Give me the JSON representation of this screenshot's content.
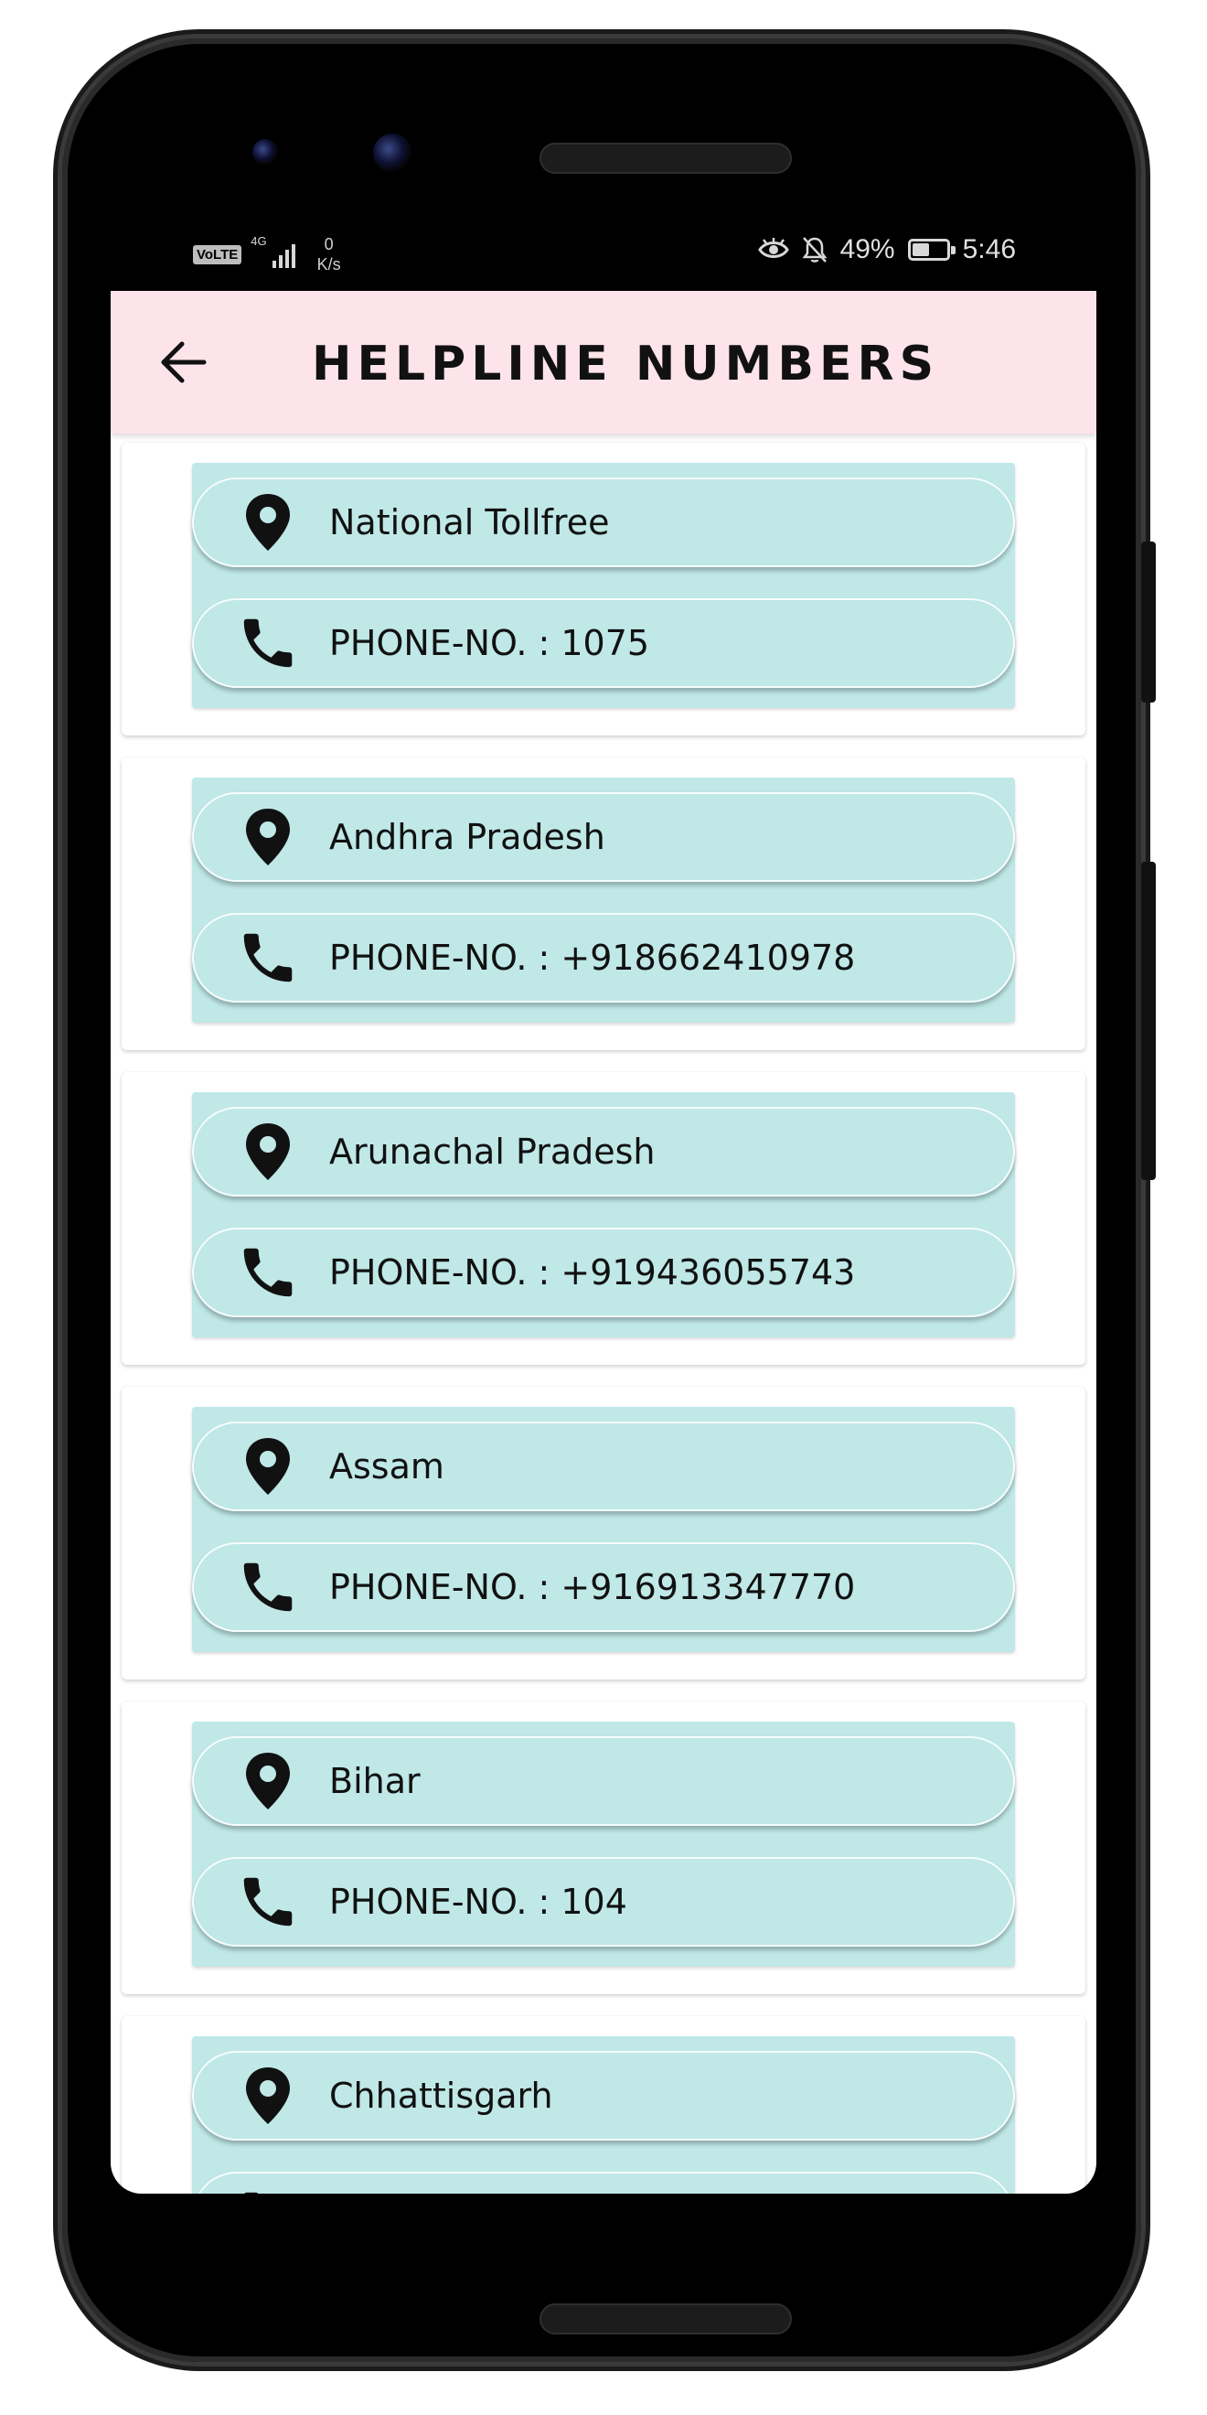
{
  "status_bar": {
    "volte": "VoLTE",
    "network": "4G",
    "speed_value": "0",
    "speed_unit": "K/s",
    "battery": "49%",
    "battery_level": 0.49,
    "time": "5:46"
  },
  "app_bar": {
    "title": "HELPLINE NUMBERS",
    "background": "#fde4ea"
  },
  "colors": {
    "card_inner": "#bfe8e7",
    "accent_text": "#111111"
  },
  "helplines": [
    {
      "location": "National Tollfree",
      "phone": "PHONE-NO. : 1075"
    },
    {
      "location": "Andhra Pradesh",
      "phone": "PHONE-NO. : +918662410978"
    },
    {
      "location": "Arunachal Pradesh",
      "phone": "PHONE-NO. : +919436055743"
    },
    {
      "location": "Assam",
      "phone": "PHONE-NO. : +916913347770"
    },
    {
      "location": "Bihar",
      "phone": "PHONE-NO. : 104"
    },
    {
      "location": "Chhattisgarh",
      "phone": ""
    }
  ],
  "icons": {
    "back": "arrow-left-icon",
    "location": "location-pin-icon",
    "phone": "phone-icon"
  }
}
